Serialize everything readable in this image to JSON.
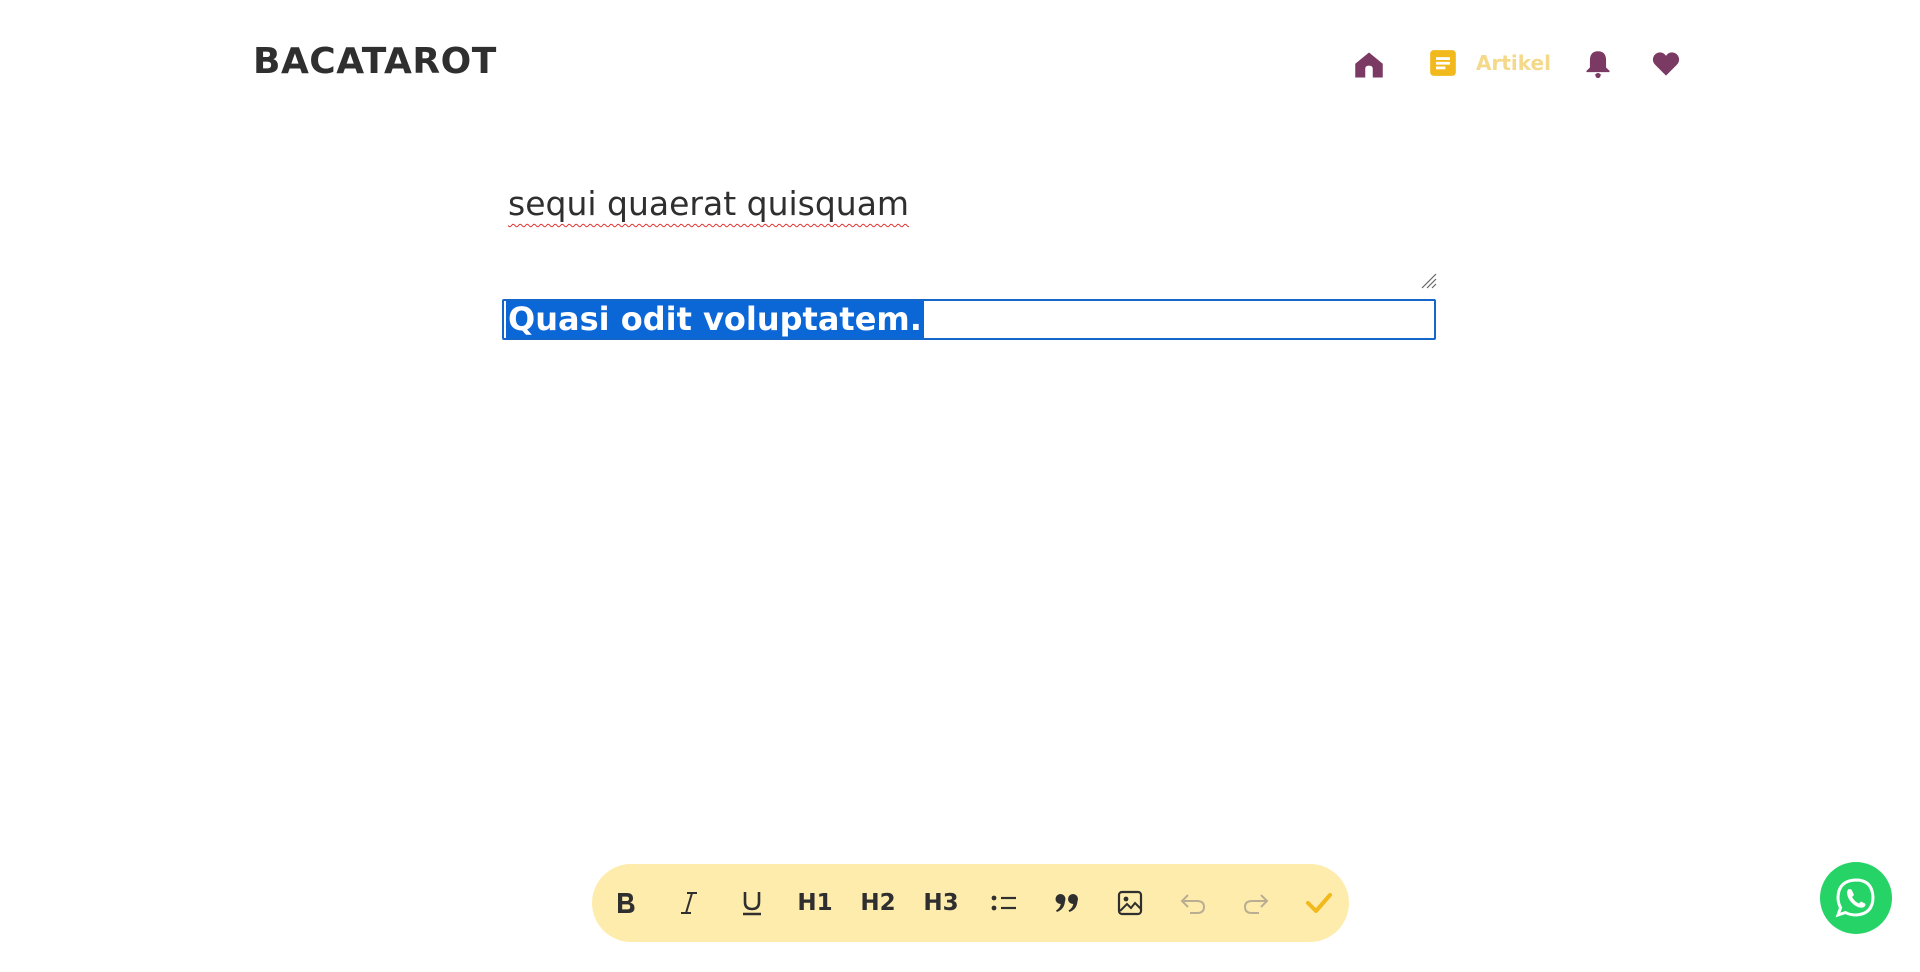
{
  "header": {
    "logo": "BACATAROT",
    "nav": {
      "active_label": "Artikel",
      "icons": [
        "home-icon",
        "article-icon",
        "bell-icon",
        "heart-icon"
      ]
    }
  },
  "editor": {
    "title_value": "sequi quaerat quisquam",
    "body_selected_text": "Quasi odit voluptatem."
  },
  "toolbar": {
    "h1": "H1",
    "h2": "H2",
    "h3": "H3",
    "icons": [
      "bold-icon",
      "italic-icon",
      "underline-icon",
      "bullet-list-icon",
      "quote-icon",
      "image-icon",
      "undo-icon",
      "redo-icon",
      "check-icon"
    ]
  },
  "colors": {
    "brand_plum": "#7b3a63",
    "accent_yellow": "#f2b91c",
    "active_label": "#f4d98a",
    "toolbar_bg": "#feecad",
    "selection_blue": "#0b66d6",
    "whatsapp_green": "#25d366"
  }
}
